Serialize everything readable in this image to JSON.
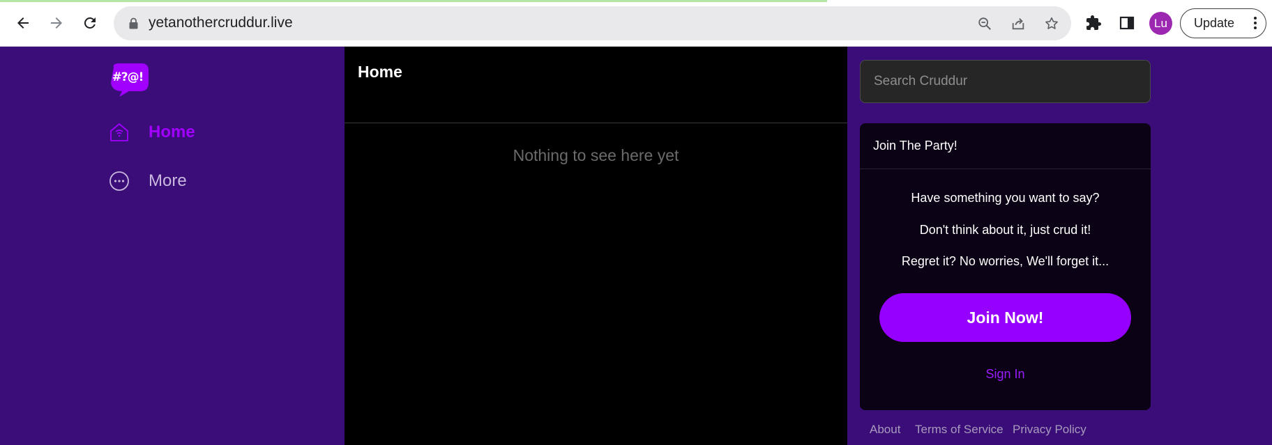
{
  "browser": {
    "url": "yetanothercruddur.live",
    "profile_initials": "Lu",
    "update_label": "Update",
    "load_progress": 0.65
  },
  "sidebar": {
    "logo_text": "#?@!",
    "items": [
      {
        "label": "Home",
        "icon": "home-icon",
        "active": true
      },
      {
        "label": "More",
        "icon": "more-icon",
        "active": false
      }
    ]
  },
  "main": {
    "title": "Home",
    "empty_message": "Nothing to see here yet"
  },
  "search": {
    "placeholder": "Search Cruddur"
  },
  "join": {
    "header": "Join The Party!",
    "lines": [
      "Have something you want to say?",
      "Don't think about it, just crud it!",
      "Regret it? No worries, We'll forget it..."
    ],
    "join_button": "Join Now!",
    "sign_in": "Sign In"
  },
  "footer": {
    "links": [
      "About",
      "Terms of Service",
      "Privacy Policy"
    ]
  },
  "colors": {
    "background": "#3b0d78",
    "accent": "#9500ff",
    "feed": "#000000"
  }
}
